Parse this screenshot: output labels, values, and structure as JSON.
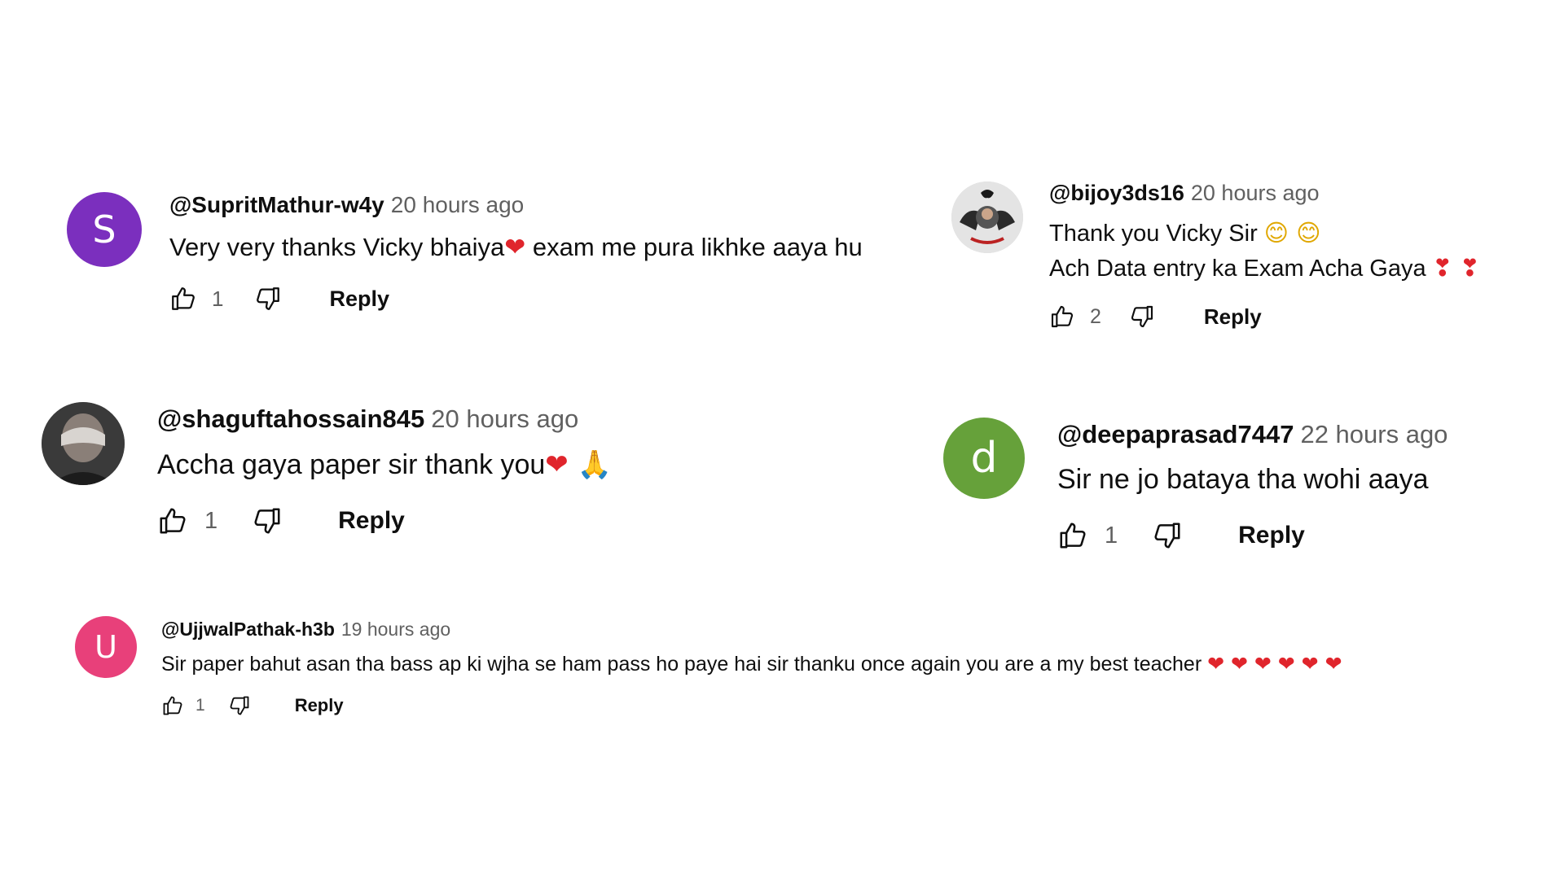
{
  "comments": [
    {
      "author": "@SupritMathur-w4y",
      "time": "20 hours ago",
      "avatar_letter": "S",
      "avatar_color": "#7b2fbe",
      "lines": [
        [
          "Very very thanks Vicky bhaiya",
          "❤",
          " exam me pura likhke aaya hu"
        ]
      ],
      "likes": "1",
      "reply": "Reply"
    },
    {
      "author": "@bijoy3ds16",
      "time": "20 hours ago",
      "avatar_letter": "",
      "avatar_color": "#3a3a3a",
      "lines": [
        [
          "Thank you Vicky Sir ",
          "😊 😊"
        ],
        [
          "Ach Data entry ka Exam Acha Gaya ",
          "❣ ❣"
        ]
      ],
      "likes": "2",
      "reply": "Reply"
    },
    {
      "author": "@shaguftahossain845",
      "time": "20 hours ago",
      "avatar_letter": "",
      "avatar_color": "#4a4a4a",
      "lines": [
        [
          "Accha gaya paper sir thank you",
          "❤ 🙏"
        ]
      ],
      "likes": "1",
      "reply": "Reply"
    },
    {
      "author": "@deepaprasad7447",
      "time": "22 hours ago",
      "avatar_letter": "d",
      "avatar_color": "#66a13a",
      "lines": [
        [
          "Sir ne jo bataya tha wohi aaya"
        ]
      ],
      "likes": "1",
      "reply": "Reply"
    },
    {
      "author": "@UjjwalPathak-h3b",
      "time": "19 hours ago",
      "avatar_letter": "U",
      "avatar_color": "#e8407a",
      "lines": [
        [
          "Sir paper bahut asan tha bass ap ki wjha se ham pass ho paye hai sir thanku once again you are a my best teacher ",
          "❤ ❤ ❤ ❤ ❤ ❤"
        ]
      ],
      "likes": "1",
      "reply": "Reply"
    }
  ]
}
